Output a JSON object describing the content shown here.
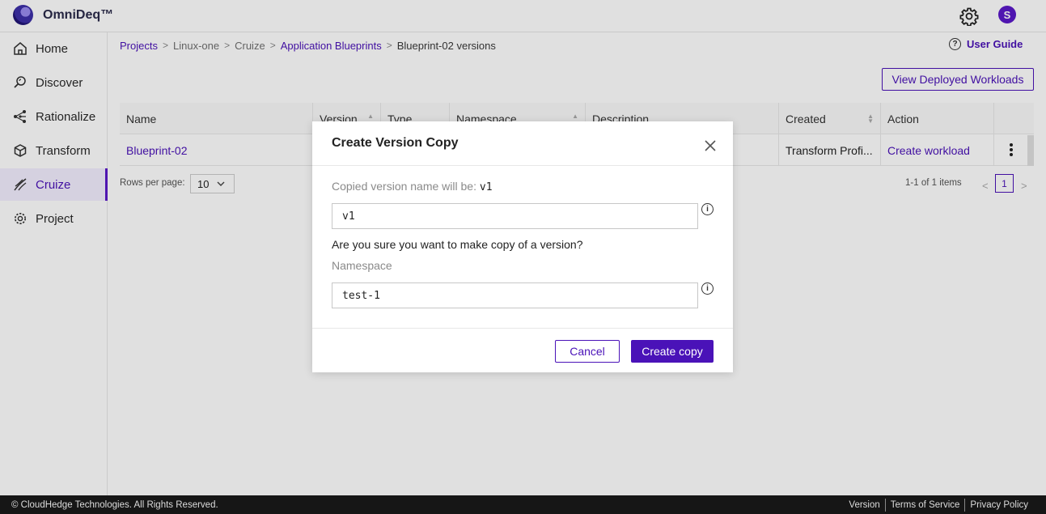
{
  "app": {
    "brand": "OmniDeq™",
    "avatar_initial": "S",
    "accent": "#4a12b8"
  },
  "sidebar": {
    "items": [
      {
        "label": "Home",
        "icon": "home-icon"
      },
      {
        "label": "Discover",
        "icon": "discover-icon"
      },
      {
        "label": "Rationalize",
        "icon": "rationalize-icon"
      },
      {
        "label": "Transform",
        "icon": "cube-icon"
      },
      {
        "label": "Cruize",
        "icon": "cruize-icon",
        "active": true
      },
      {
        "label": "Project",
        "icon": "gear-icon"
      }
    ]
  },
  "breadcrumb": {
    "items": [
      "Projects",
      "Linux-one",
      "Cruize",
      "Application Blueprints",
      "Blueprint-02 versions"
    ],
    "separator": ">"
  },
  "header": {
    "user_guide": "User Guide",
    "help_glyph": "?"
  },
  "toolbar": {
    "view_deployed": "View Deployed Workloads"
  },
  "table": {
    "columns": [
      "Name",
      "Version",
      "Type",
      "Namespace",
      "Description",
      "Created",
      "Action"
    ],
    "rows": [
      {
        "name": "Blueprint-02",
        "created": "Transform Profi...",
        "action": "Create workload"
      }
    ]
  },
  "pagination": {
    "rows_per_page_label": "Rows per page:",
    "rows_per_page": "10",
    "info": "1-1 of 1 items",
    "current_page": "1",
    "prev": "<",
    "next": ">"
  },
  "modal": {
    "title": "Create Version Copy",
    "copied_label": "Copied version name will be:",
    "copied_value": "v1",
    "version_input": "v1",
    "question": "Are you sure you want to make copy of a version?",
    "namespace_label": "Namespace",
    "namespace_input": "test-1",
    "info_glyph": "i",
    "cancel": "Cancel",
    "create": "Create copy"
  },
  "footer": {
    "copyright": "© CloudHedge Technologies. All Rights Reserved.",
    "links": [
      "Version",
      "Terms of Service",
      "Privacy Policy"
    ]
  }
}
